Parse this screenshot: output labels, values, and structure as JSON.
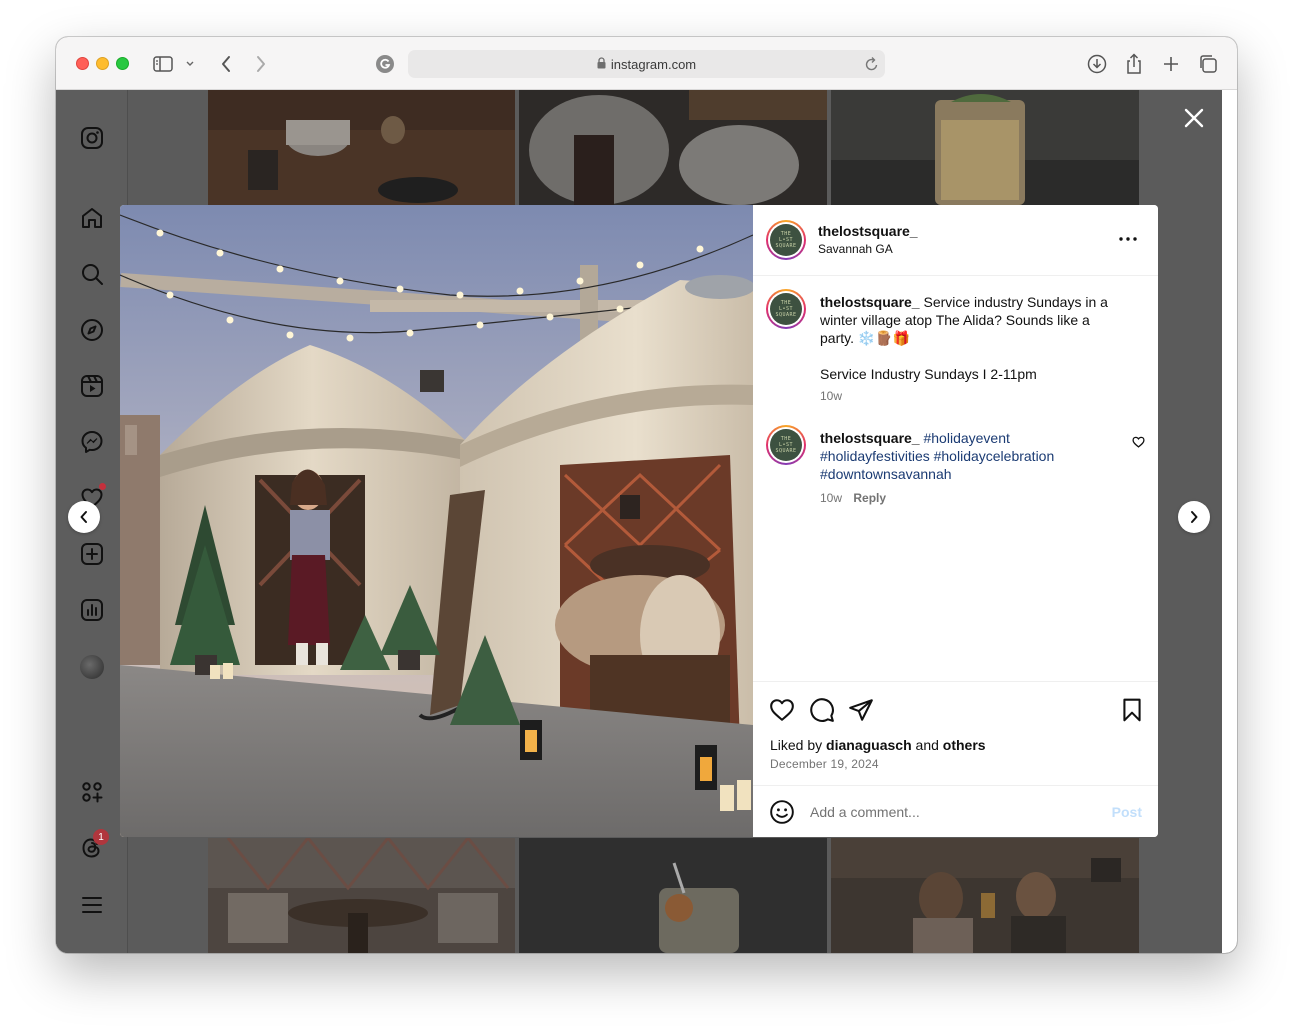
{
  "browser": {
    "url": "instagram.com"
  },
  "post": {
    "username": "thelostsquare_",
    "location": "Savannah GA",
    "avatar_text": [
      "THE",
      "L•ST",
      "SQUARE"
    ],
    "caption": {
      "username": "thelostsquare_",
      "text_line": "Service industry Sundays in a winter village atop The Alida? Sounds like a party. ❄️🪵🎁",
      "detail": "Service Industry Sundays I 2-11pm",
      "time": "10w"
    },
    "comment": {
      "username": "thelostsquare_",
      "hashtags": "#holidayevent #holidayfestivities #holidaycelebration #downtownsavannah",
      "time": "10w",
      "reply_label": "Reply"
    },
    "liked_by_prefix": "Liked by",
    "liked_by_user": "dianaguasch",
    "liked_by_and": "and",
    "liked_by_others": "others",
    "date": "December 19, 2024",
    "comment_placeholder": "Add a comment...",
    "post_label": "Post"
  },
  "sidebar": {
    "notification_badge": "1"
  },
  "colors": {
    "hashtag": "#1b3b73",
    "post_disabled": "#c2dffb",
    "notification": "#c4303c"
  }
}
